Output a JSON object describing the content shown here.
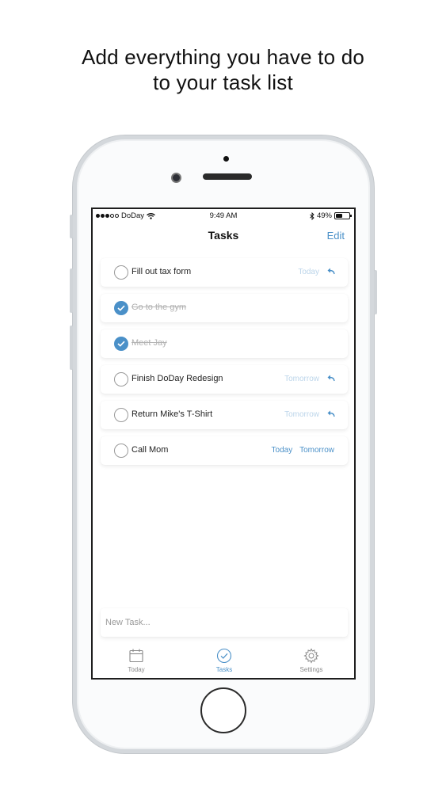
{
  "headline": {
    "line1": "Add everything you have to do",
    "line2": "to your task list"
  },
  "status_bar": {
    "carrier": "DoDay",
    "time": "9:49 AM",
    "battery": "49%",
    "battery_level": 0.49
  },
  "nav": {
    "title": "Tasks",
    "edit_label": "Edit"
  },
  "tasks": [
    {
      "text": "Fill out tax form",
      "done": false,
      "due": [
        "Today"
      ],
      "due_style": "faint",
      "reply_icon": true
    },
    {
      "text": "Go to the gym",
      "done": true,
      "due": [],
      "reply_icon": false
    },
    {
      "text": "Meet Jay",
      "done": true,
      "due": [],
      "reply_icon": false
    },
    {
      "text": "Finish DoDay Redesign",
      "done": false,
      "due": [
        "Tomorrow"
      ],
      "due_style": "faint",
      "reply_icon": true
    },
    {
      "text": "Return Mike's T-Shirt",
      "done": false,
      "due": [
        "Tomorrow"
      ],
      "due_style": "faint",
      "reply_icon": true
    },
    {
      "text": "Call Mom",
      "done": false,
      "due": [
        "Today",
        "Tomorrow"
      ],
      "due_style": "bold",
      "reply_icon": false
    }
  ],
  "new_task": {
    "placeholder": "New Task..."
  },
  "tabs": [
    {
      "label": "Today",
      "icon": "calendar-icon",
      "active": false
    },
    {
      "label": "Tasks",
      "icon": "check-circle-icon",
      "active": true
    },
    {
      "label": "Settings",
      "icon": "gear-icon",
      "active": false
    }
  ],
  "colors": {
    "accent": "#4a90c8",
    "accent_faint": "#bcd5ea",
    "done_text": "#b2b2b2"
  }
}
